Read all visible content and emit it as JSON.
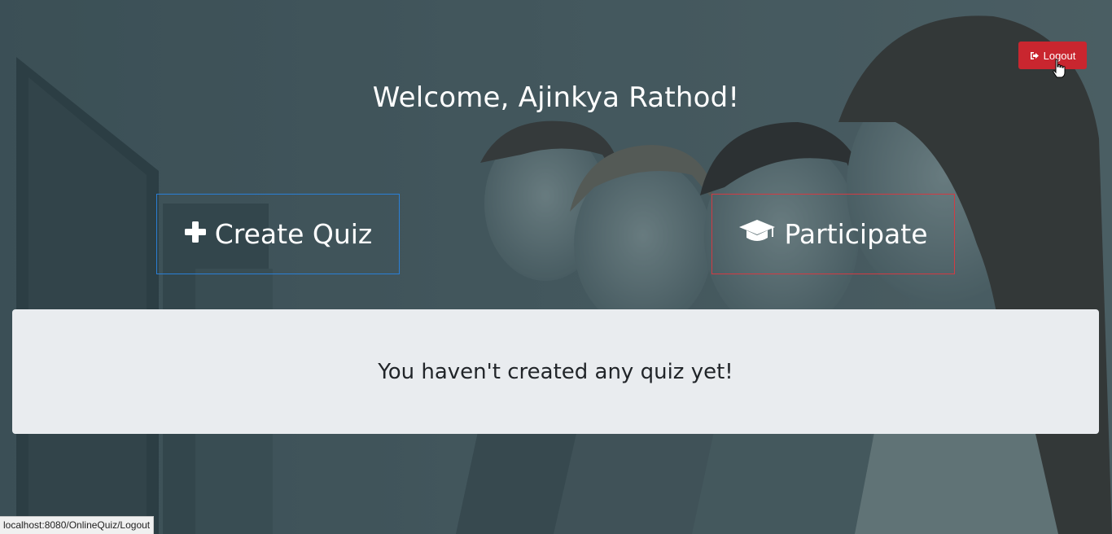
{
  "header": {
    "logout_label": "Logout",
    "welcome_text": "Welcome, Ajinkya Rathod!"
  },
  "actions": {
    "create_label": "Create Quiz",
    "participate_label": "Participate"
  },
  "panel": {
    "message": "You haven't created any quiz yet!"
  },
  "status_bar": {
    "url": "localhost:8080/OnlineQuiz/Logout"
  },
  "colors": {
    "logout_bg": "#c9262f",
    "create_border": "#2a7fd6",
    "participate_border": "#d23b43",
    "panel_bg": "#e9ecef"
  },
  "icons": {
    "logout": "sign-out-icon",
    "create": "plus-icon",
    "participate": "graduation-cap-icon",
    "cursor": "hand-pointer-icon"
  }
}
